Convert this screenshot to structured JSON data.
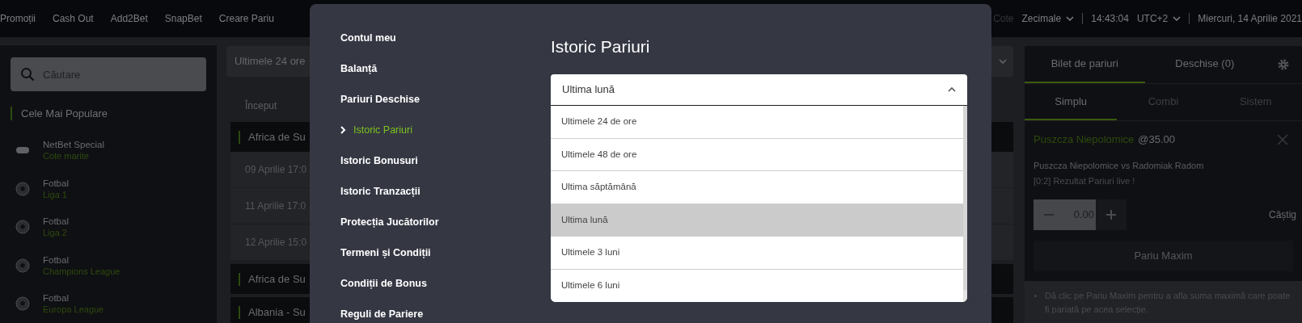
{
  "top_nav": {
    "links": [
      "Promoții",
      "Cash Out",
      "Add2Bet",
      "SnapBet",
      "Creare Pariu"
    ],
    "odds_label": "Cote",
    "odds_format": "Zecimale",
    "clock": "14:43:04",
    "timezone": "UTC+2",
    "date": "Miercuri, 14 Aprilie 2021"
  },
  "sidebar": {
    "search_placeholder": "Căutare",
    "section_title": "Cele Mai Populare",
    "items": [
      {
        "kind": "special",
        "title": "NetBet Special",
        "subtitle": "Cote marite"
      },
      {
        "kind": "football",
        "title": "Fotbal",
        "subtitle": "Liga 1"
      },
      {
        "kind": "football",
        "title": "Fotbal",
        "subtitle": "Liga 2"
      },
      {
        "kind": "football",
        "title": "Fotbal",
        "subtitle": "Champions League"
      },
      {
        "kind": "football",
        "title": "Fotbal",
        "subtitle": "Europa League"
      }
    ]
  },
  "events": {
    "filter": "Ultimele 24 ore",
    "column_1": "Început",
    "rows": [
      {
        "kind": "group",
        "text": "Africa de Su"
      },
      {
        "kind": "event",
        "text": "09 Aprilie 17:0"
      },
      {
        "kind": "event",
        "text": "11 Aprilie 17:0"
      },
      {
        "kind": "event",
        "text": "12 Aprilie 15:0"
      },
      {
        "kind": "group",
        "text": "Africa de Su"
      },
      {
        "kind": "group",
        "text": "Albania - Su"
      }
    ]
  },
  "betslip": {
    "tabs": [
      {
        "label": "Bilet de pariuri",
        "selected": true
      },
      {
        "label": "Deschise (0)",
        "selected": false
      }
    ],
    "bet_types": [
      {
        "label": "Simplu",
        "selected": true
      },
      {
        "label": "Combi",
        "selected": false
      },
      {
        "label": "Sistem",
        "selected": false
      }
    ],
    "selection": {
      "team": "Puszcza Niepolomice",
      "odds": "@35.00",
      "match": "Puszcza Niepolomice vs Radomiak Radom",
      "market": "[0:2] Rezultat Pariuri live !"
    },
    "stake": "0.00",
    "win_label": "Câștig",
    "max_button": "Pariu Maxim",
    "hint": "Dă clic pe Pariu Maxim pentru a afla suma maximă care poate fi pariată pe acea selecție."
  },
  "modal": {
    "menu": [
      {
        "label": "Contul meu",
        "selected": false
      },
      {
        "label": "Balanță",
        "selected": false
      },
      {
        "label": "Pariuri Deschise",
        "selected": false
      },
      {
        "label": "Istoric Pariuri",
        "selected": true
      },
      {
        "label": "Istoric Bonusuri",
        "selected": false
      },
      {
        "label": "Istoric Tranzacții",
        "selected": false
      },
      {
        "label": "Protecția Jucătorilor",
        "selected": false
      },
      {
        "label": "Termeni și Condiții",
        "selected": false
      },
      {
        "label": "Condiții de Bonus",
        "selected": false
      },
      {
        "label": "Reguli de Pariere",
        "selected": false
      }
    ],
    "title": "Istoric Pariuri",
    "select": {
      "value": "Ultima lună",
      "expanded": true,
      "options": [
        {
          "label": "Ultimele 24 de ore",
          "selected": false
        },
        {
          "label": "Ultimele 48 de ore",
          "selected": false
        },
        {
          "label": "Ultima săptămână",
          "selected": false
        },
        {
          "label": "Ultima lună",
          "selected": true
        },
        {
          "label": "Ultimele 3 luni",
          "selected": false
        },
        {
          "label": "Ultimele 6 luni",
          "selected": false
        }
      ]
    }
  }
}
